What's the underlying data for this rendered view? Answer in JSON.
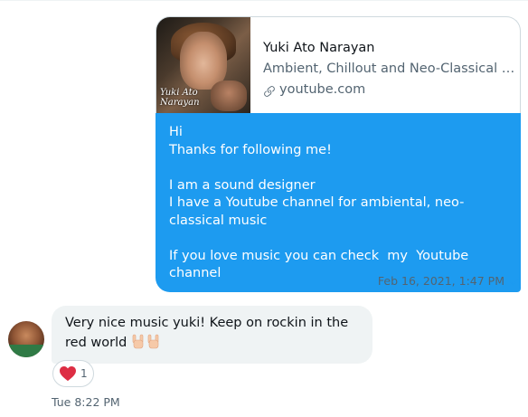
{
  "outgoing": {
    "link_card": {
      "thumbnail_caption": "Yuki Ato Narayan",
      "title": "Yuki Ato Narayan",
      "description": "Ambient, Chillout and Neo-Classical mu...",
      "domain": "youtube.com",
      "domain_icon": "link-icon"
    },
    "message_lines": [
      "Hi",
      "Thanks for following me!",
      "",
      "I am a sound designer",
      "I have a Youtube channel for ambiental, neo-classical music",
      "",
      "If you love music you can check  my  Youtube channel"
    ],
    "timestamp": "Feb 16, 2021, 1:47 PM",
    "status_icon": "check-icon",
    "bubble_color": "#1d9bf0"
  },
  "incoming": {
    "avatar_icon": "avatar",
    "message": "Very nice music yuki! Keep on rockin in the red world",
    "emoji": "🤘🤘",
    "reaction": {
      "icon": "heart-icon",
      "count": "1",
      "color": "#e0245e"
    },
    "timestamp": "Tue 8:22 PM",
    "bubble_color": "#eff3f4"
  }
}
